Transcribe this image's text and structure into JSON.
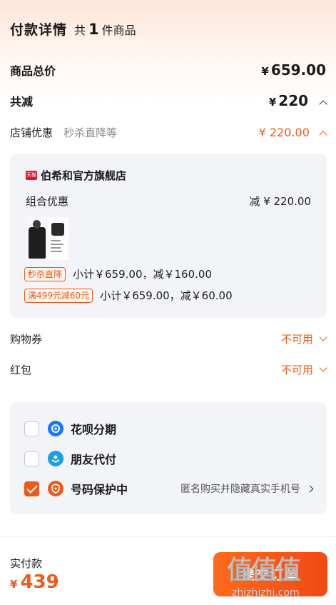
{
  "header": {
    "title": "付款详情",
    "count_prefix": "共",
    "count": "1",
    "count_suffix": "件商品"
  },
  "total": {
    "label": "商品总价",
    "currency": "¥",
    "amount": "659.00"
  },
  "discount": {
    "label": "共减",
    "currency": "¥",
    "amount": "220"
  },
  "shop_discount": {
    "label": "店铺优惠",
    "sub": "秒杀直降等",
    "amount": "¥ 220.00"
  },
  "store": {
    "badge": "天猫",
    "name": "伯希和官方旗舰店",
    "combo_label": "组合优惠",
    "combo_amount": "减 ¥ 220.00",
    "discounts": [
      {
        "tag": "秒杀直降",
        "text": "小计￥659.00，减￥160.00"
      },
      {
        "tag": "满499元减60元",
        "text": "小计￥659.00，减￥60.00"
      }
    ]
  },
  "coupon": {
    "label": "购物券",
    "value": "不可用"
  },
  "redpacket": {
    "label": "红包",
    "value": "不可用"
  },
  "payment_options": [
    {
      "label": "花呗分期",
      "checked": false,
      "icon": "huabei-icon",
      "icon_color": "#1677ff"
    },
    {
      "label": "朋友代付",
      "checked": false,
      "icon": "friend-pay-icon",
      "icon_color": "#1aa0e8"
    },
    {
      "label": "号码保护中",
      "checked": true,
      "icon": "phone-protect-icon",
      "icon_color": "#ee5a17",
      "right_text": "匿名购买并隐藏真实手机号"
    }
  ],
  "footer": {
    "paid_label": "实付款",
    "currency": "¥",
    "paid_amount": "439",
    "submit_label": "提交订单"
  },
  "watermark": {
    "text": "值值值",
    "url": "zhizhizhi.com"
  },
  "colors": {
    "accent": "#ee5a17",
    "card_bg": "#f2f4f7"
  }
}
